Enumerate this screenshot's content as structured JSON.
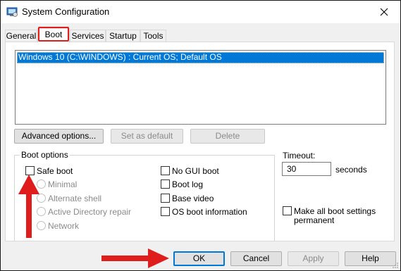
{
  "window": {
    "title": "System Configuration"
  },
  "tabs": [
    {
      "label": "General",
      "active": false
    },
    {
      "label": "Boot",
      "active": true
    },
    {
      "label": "Services",
      "active": false
    },
    {
      "label": "Startup",
      "active": false
    },
    {
      "label": "Tools",
      "active": false
    }
  ],
  "os_list": {
    "items": [
      "Windows 10 (C:\\WINDOWS) : Current OS; Default OS"
    ],
    "selected_index": 0
  },
  "list_buttons": {
    "advanced": "Advanced options...",
    "set_default": "Set as default",
    "delete": "Delete"
  },
  "boot_options": {
    "group_label": "Boot options",
    "safe_boot": {
      "label": "Safe boot",
      "checked": false
    },
    "radios": {
      "minimal": "Minimal",
      "alternate_shell": "Alternate shell",
      "active_directory": "Active Directory repair",
      "network": "Network"
    },
    "no_gui_boot": {
      "label": "No GUI boot",
      "checked": false
    },
    "boot_log": {
      "label": "Boot log",
      "checked": false
    },
    "base_video": {
      "label": "Base video",
      "checked": false
    },
    "os_boot_info": {
      "label": "OS boot information",
      "checked": false
    }
  },
  "timeout": {
    "label": "Timeout:",
    "value": "30",
    "unit": "seconds"
  },
  "permanent": {
    "line1": "Make all boot settings",
    "line2": "permanent",
    "checked": false
  },
  "dialog_buttons": {
    "ok": "OK",
    "cancel": "Cancel",
    "apply": "Apply",
    "help": "Help"
  },
  "colors": {
    "selection": "#0078d7",
    "annotation_red": "#e01d1d"
  }
}
